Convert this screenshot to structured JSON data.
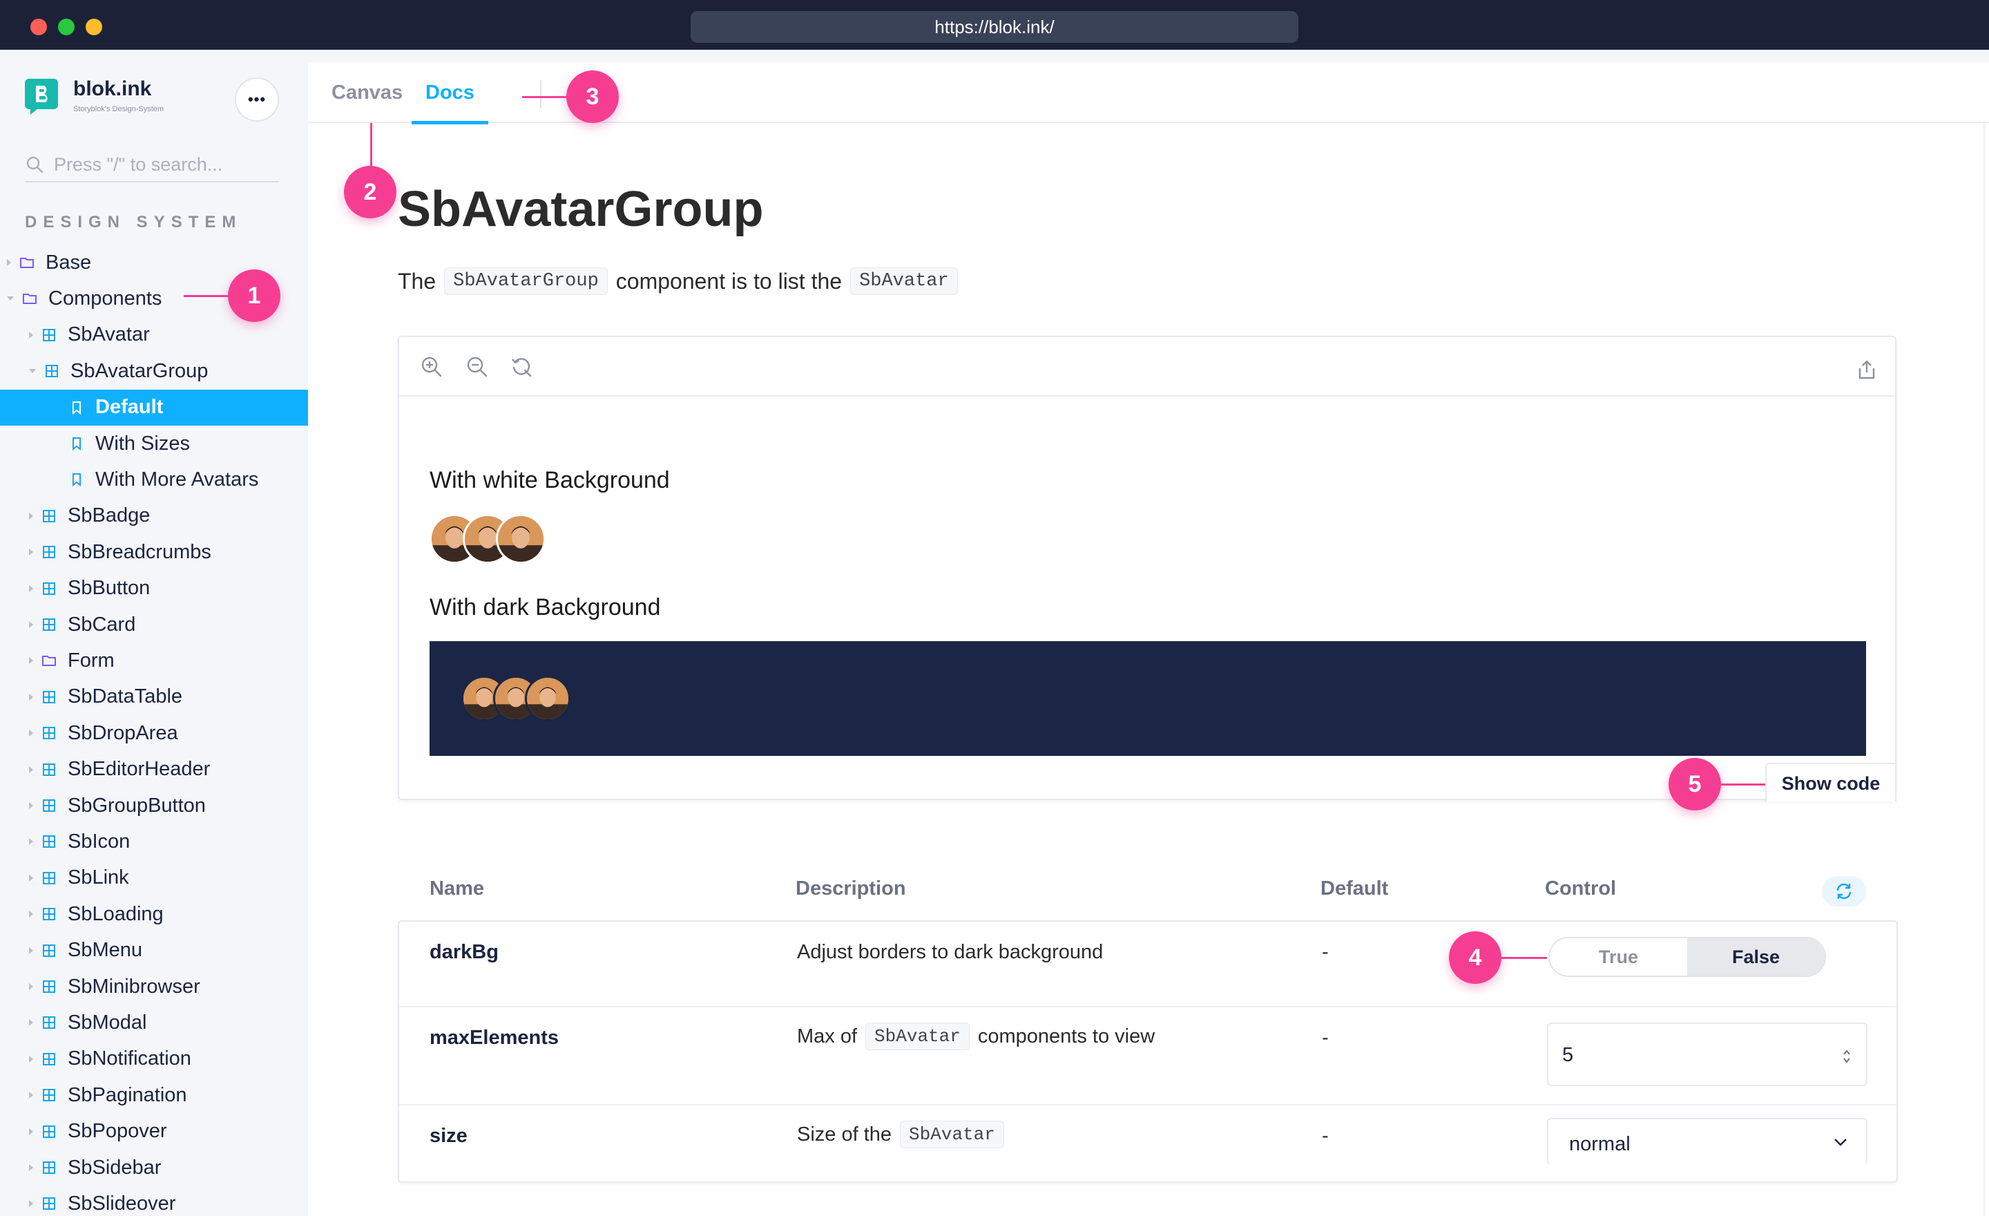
{
  "browser": {
    "url": "https://blok.ink/"
  },
  "sidebar": {
    "brand_name": "blok.ink",
    "brand_subtitle": "Storyblok's Design-System",
    "more_label": "•••",
    "search_placeholder": "Press \"/\" to search...",
    "section_title": "DESIGN SYSTEM",
    "items": [
      {
        "label": "Base",
        "kind": "folder",
        "level": 0,
        "state": "collapsed"
      },
      {
        "label": "Components",
        "kind": "folder",
        "level": 0,
        "state": "expanded"
      },
      {
        "label": "SbAvatar",
        "kind": "component",
        "level": 1,
        "state": "collapsed"
      },
      {
        "label": "SbAvatarGroup",
        "kind": "component",
        "level": 1,
        "state": "expanded"
      },
      {
        "label": "Default",
        "kind": "story",
        "level": 2,
        "state": "selected"
      },
      {
        "label": "With Sizes",
        "kind": "story",
        "level": 2,
        "state": "none"
      },
      {
        "label": "With More Avatars",
        "kind": "story",
        "level": 2,
        "state": "none"
      },
      {
        "label": "SbBadge",
        "kind": "component",
        "level": 1,
        "state": "collapsed"
      },
      {
        "label": "SbBreadcrumbs",
        "kind": "component",
        "level": 1,
        "state": "collapsed"
      },
      {
        "label": "SbButton",
        "kind": "component",
        "level": 1,
        "state": "collapsed"
      },
      {
        "label": "SbCard",
        "kind": "component",
        "level": 1,
        "state": "collapsed"
      },
      {
        "label": "Form",
        "kind": "folder",
        "level": 1,
        "state": "collapsed"
      },
      {
        "label": "SbDataTable",
        "kind": "component",
        "level": 1,
        "state": "collapsed"
      },
      {
        "label": "SbDropArea",
        "kind": "component",
        "level": 1,
        "state": "collapsed"
      },
      {
        "label": "SbEditorHeader",
        "kind": "component",
        "level": 1,
        "state": "collapsed"
      },
      {
        "label": "SbGroupButton",
        "kind": "component",
        "level": 1,
        "state": "collapsed"
      },
      {
        "label": "SbIcon",
        "kind": "component",
        "level": 1,
        "state": "collapsed"
      },
      {
        "label": "SbLink",
        "kind": "component",
        "level": 1,
        "state": "collapsed"
      },
      {
        "label": "SbLoading",
        "kind": "component",
        "level": 1,
        "state": "collapsed"
      },
      {
        "label": "SbMenu",
        "kind": "component",
        "level": 1,
        "state": "collapsed"
      },
      {
        "label": "SbMinibrowser",
        "kind": "component",
        "level": 1,
        "state": "collapsed"
      },
      {
        "label": "SbModal",
        "kind": "component",
        "level": 1,
        "state": "collapsed"
      },
      {
        "label": "SbNotification",
        "kind": "component",
        "level": 1,
        "state": "collapsed"
      },
      {
        "label": "SbPagination",
        "kind": "component",
        "level": 1,
        "state": "collapsed"
      },
      {
        "label": "SbPopover",
        "kind": "component",
        "level": 1,
        "state": "collapsed"
      },
      {
        "label": "SbSidebar",
        "kind": "component",
        "level": 1,
        "state": "collapsed"
      },
      {
        "label": "SbSlideover",
        "kind": "component",
        "level": 1,
        "state": "collapsed"
      }
    ]
  },
  "tabs": {
    "canvas": "Canvas",
    "docs": "Docs",
    "active": "Docs"
  },
  "doc": {
    "title": "SbAvatarGroup",
    "intro_prefix": "The",
    "intro_code1": "SbAvatarGroup",
    "intro_middle": "component is to list the",
    "intro_code2": "SbAvatar"
  },
  "preview": {
    "toolbar_icons": [
      "zoom-in-icon",
      "zoom-out-icon",
      "reset-zoom-icon",
      "share-icon"
    ],
    "white_heading": "With white Background",
    "dark_heading": "With dark Background",
    "dark_background_color": "#1b2545",
    "show_code_label": "Show code"
  },
  "args_table": {
    "headers": {
      "name": "Name",
      "description": "Description",
      "default": "Default",
      "control": "Control"
    },
    "rows": [
      {
        "name": "darkBg",
        "description": "Adjust borders to dark background",
        "default": "-",
        "control": {
          "type": "toggle",
          "true_label": "True",
          "false_label": "False",
          "selected": "False"
        }
      },
      {
        "name": "maxElements",
        "description_prefix": "Max of",
        "description_code": "SbAvatar",
        "description_suffix": "components to view",
        "default": "-",
        "control": {
          "type": "number",
          "value": "5"
        }
      },
      {
        "name": "size",
        "description_prefix": "Size of the",
        "description_code": "SbAvatar",
        "default": "-",
        "control": {
          "type": "select",
          "value": "normal"
        }
      }
    ]
  },
  "annotations": [
    "1",
    "2",
    "3",
    "4",
    "5"
  ],
  "colors": {
    "accent": "#0fb0ff",
    "marker": "#f53e92",
    "titlebar": "#1b2238",
    "sidebar_bg": "#f4f6fa",
    "folder_icon": "#7a5af8",
    "component_icon": "#1aa3e8"
  }
}
